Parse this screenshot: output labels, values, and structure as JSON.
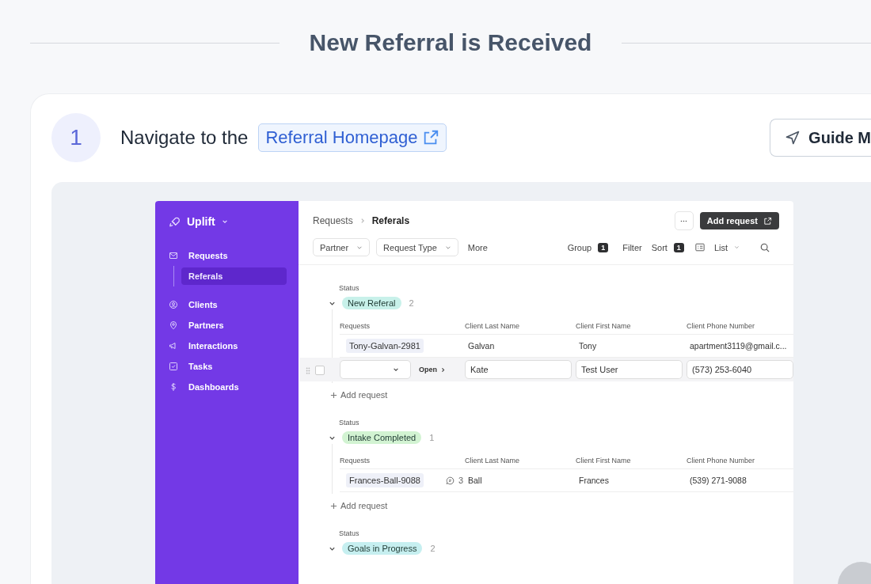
{
  "heading": "New Referral is Received",
  "step": {
    "number": "1",
    "text": "Navigate to the",
    "link": "Referral Homepage"
  },
  "guide_button": {
    "label": "Guide M"
  },
  "app": {
    "brand": "Uplift",
    "nav": [
      {
        "label": "Requests",
        "selected": false,
        "children": [
          {
            "label": "Referals",
            "selected": true
          }
        ]
      },
      {
        "label": "Clients",
        "selected": false
      },
      {
        "label": "Partners",
        "selected": false
      },
      {
        "label": "Interactions",
        "selected": false
      },
      {
        "label": "Tasks",
        "selected": false
      },
      {
        "label": "Dashboards",
        "selected": false
      }
    ],
    "breadcrumb": [
      "Requests",
      "Referals"
    ],
    "add_request_button": "Add request",
    "filters": [
      "Partner",
      "Request Type"
    ],
    "more": "More",
    "tools": [
      {
        "kind": "count",
        "label": "Group",
        "count": "1"
      },
      {
        "kind": "plain",
        "label": "Filter"
      },
      {
        "kind": "count",
        "label": "Sort",
        "count": "1"
      },
      {
        "kind": "view",
        "label": "List"
      }
    ],
    "groups": [
      {
        "status_label": "Status",
        "name": "New Referal",
        "color": "#c8f1ea",
        "count": "2",
        "expanded": true,
        "columns": [
          "Requests",
          "Client Last Name",
          "Client First Name",
          "Client Phone Number"
        ],
        "rows": [
          {
            "kind": "record",
            "request": "Tony-Galvan-2981",
            "last": "Galvan",
            "first": "Tony",
            "phone": "apartment3119@gmail.c..."
          },
          {
            "kind": "edit",
            "checked": false,
            "open": "Open",
            "last": "Kate",
            "first": "Test User",
            "phone": "(573) 253-6040"
          }
        ],
        "add_label": "Add request"
      },
      {
        "status_label": "Status",
        "name": "Intake Completed",
        "color": "#d2f3d2",
        "count": "1",
        "expanded": true,
        "columns": [
          "Requests",
          "Client Last Name",
          "Client First Name",
          "Client Phone Number"
        ],
        "rows": [
          {
            "kind": "record",
            "request": "Frances-Ball-9088",
            "comments": "3",
            "last": "Ball",
            "first": "Frances",
            "phone": "(539) 271-9088"
          }
        ],
        "add_label": "Add request"
      },
      {
        "status_label": "Status",
        "name": "Goals in Progress",
        "color": "#c6eff0",
        "count": "2",
        "expanded": true
      }
    ]
  }
}
